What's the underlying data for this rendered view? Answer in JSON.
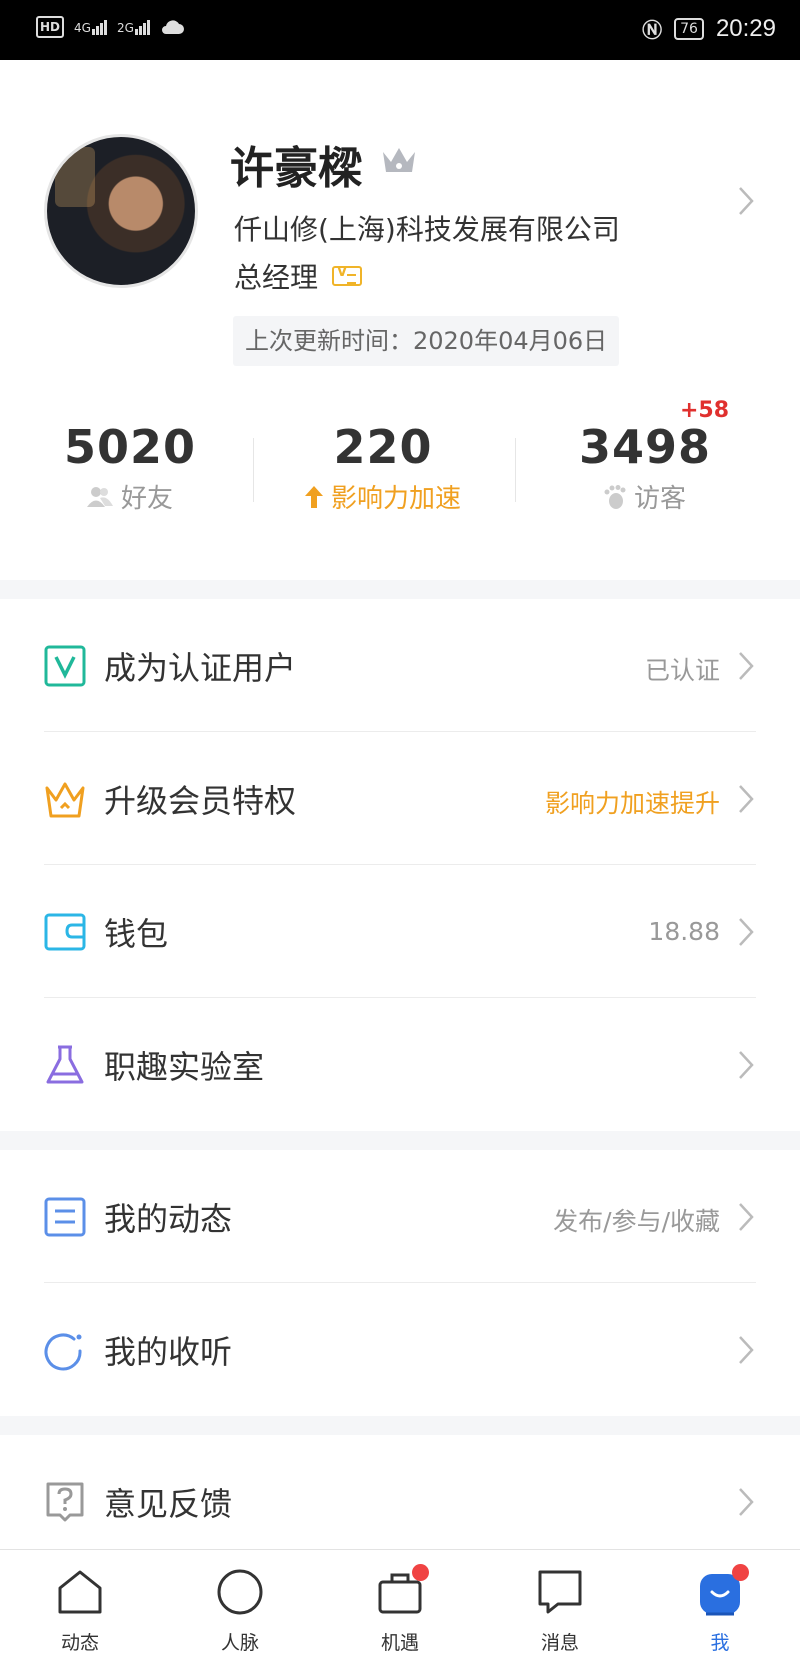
{
  "status_bar": {
    "left_badge": "HD",
    "net1": "4G",
    "net2": "2G",
    "battery": "76",
    "time": "20:29"
  },
  "profile": {
    "name": "许豪樑",
    "company": "仟山修(上海)科技发展有限公司",
    "job_title": "总经理",
    "updated": "上次更新时间：2020年04月06日"
  },
  "stats": {
    "friends": {
      "value": "5020",
      "label": "好友"
    },
    "influence": {
      "value": "220",
      "label": "影响力加速"
    },
    "visitors": {
      "value": "3498",
      "label": "访客",
      "delta": "+58"
    }
  },
  "menu_section1": [
    {
      "label": "成为认证用户",
      "value": "已认证",
      "icon": "verified-v-icon"
    },
    {
      "label": "升级会员特权",
      "value": "影响力加速提升",
      "icon": "crown-icon"
    },
    {
      "label": "钱包",
      "value": "18.88",
      "icon": "wallet-icon"
    },
    {
      "label": "职趣实验室",
      "value": "",
      "icon": "flask-icon"
    }
  ],
  "menu_section2": [
    {
      "label": "我的动态",
      "value": "发布/参与/收藏",
      "icon": "feed-card-icon"
    },
    {
      "label": "我的收听",
      "value": "",
      "icon": "follow-ring-icon"
    }
  ],
  "menu_section3": [
    {
      "label": "意见反馈",
      "value": "",
      "icon": "feedback-question-icon"
    }
  ],
  "tabbar": [
    {
      "label": "动态",
      "icon": "home-icon"
    },
    {
      "label": "人脉",
      "icon": "circle-icon"
    },
    {
      "label": "机遇",
      "icon": "briefcase-icon"
    },
    {
      "label": "消息",
      "icon": "chat-bubble-icon"
    },
    {
      "label": "我",
      "icon": "person-icon"
    }
  ],
  "colors": {
    "accent_blue": "#2a6fe0",
    "orange": "#f0a020",
    "red": "#e0302e"
  }
}
